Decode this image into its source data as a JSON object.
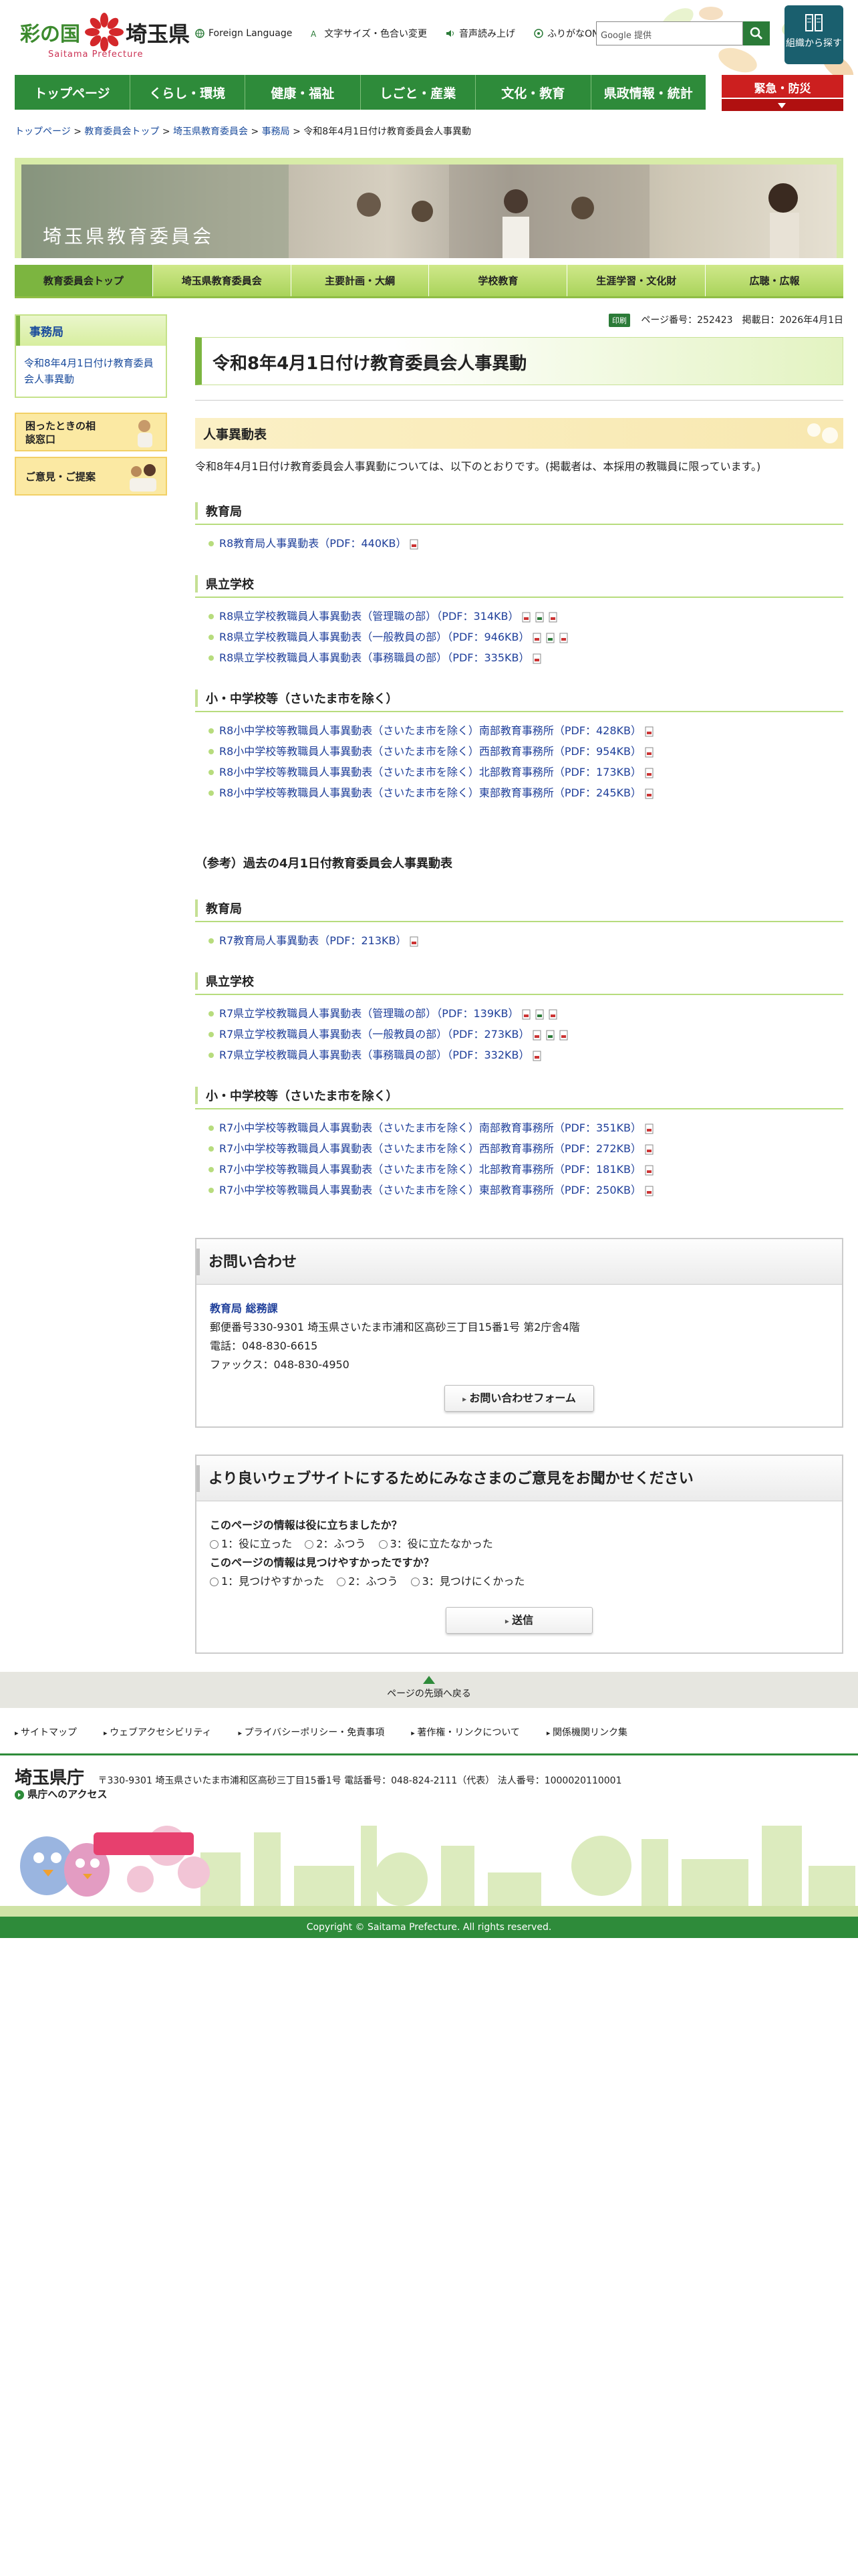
{
  "header": {
    "logo_text_sai": "彩の国",
    "logo_text_ken": "埼玉県",
    "logo_en": "Saitama Prefecture",
    "tools": [
      "Foreign Language",
      "文字サイズ・色合い変更",
      "音声読み上げ",
      "ふりがなON"
    ],
    "search_placeholder": "Google 提供",
    "org_button": "組織から探す"
  },
  "gnav": [
    "トップページ",
    "くらし・環境",
    "健康・福祉",
    "しごと・産業",
    "文化・教育",
    "県政情報・統計"
  ],
  "emergency": "緊急・防災",
  "breadcrumb": {
    "items": [
      "トップページ",
      "教育委員会トップ",
      "埼玉県教育委員会",
      "事務局"
    ],
    "current": "令和8年4月1日付け教育委員会人事異動",
    "sep": ">"
  },
  "banner": {
    "title": "埼玉県教育委員会"
  },
  "subnav": [
    "教育委員会トップ",
    "埼玉県教育委員会",
    "主要計画・大綱",
    "学校教育",
    "生涯学習・文化財",
    "広聴・広報"
  ],
  "side": {
    "head": "事務局",
    "link": "令和8年4月1日付け教育委員会人事異動",
    "btn1": "困ったときの相談窓口",
    "btn2": "ご意見・ご提案"
  },
  "page_info": {
    "badge": "印刷",
    "text": "ページ番号：252423　掲載日：2026年4月1日"
  },
  "title": "令和8年4月1日付け教育委員会人事異動",
  "section_title": "人事異動表",
  "lead": "令和8年4月1日付け教育委員会人事異動については、以下のとおりです。(掲載者は、本採用の教職員に限っています。)",
  "current": {
    "h_bureau": "教育局",
    "bureau_links": [
      "R8教育局人事異動表（PDF：440KB）"
    ],
    "h_pref": "県立学校",
    "pref_links": [
      "R8県立学校教職員人事異動表（管理職の部）（PDF：314KB）",
      "R8県立学校教職員人事異動表（一般教員の部）（PDF：946KB）",
      "R8県立学校教職員人事異動表（事務職員の部）（PDF：335KB）"
    ],
    "h_elem": "小・中学校等（さいたま市を除く）",
    "elem_links": [
      "R8小中学校等教職員人事異動表（さいたま市を除く）南部教育事務所（PDF：428KB）",
      "R8小中学校等教職員人事異動表（さいたま市を除く）西部教育事務所（PDF：954KB）",
      "R8小中学校等教職員人事異動表（さいたま市を除く）北部教育事務所（PDF：173KB）",
      "R8小中学校等教職員人事異動表（さいたま市を除く）東部教育事務所（PDF：245KB）"
    ]
  },
  "past": {
    "heading": "（参考）過去の4月1日付教育委員会人事異動表",
    "h_bureau": "教育局",
    "bureau_links": [
      "R7教育局人事異動表（PDF：213KB）"
    ],
    "h_pref": "県立学校",
    "pref_links": [
      "R7県立学校教職員人事異動表（管理職の部）（PDF：139KB）",
      "R7県立学校教職員人事異動表（一般教員の部）（PDF：273KB）",
      "R7県立学校教職員人事異動表（事務職員の部）（PDF：332KB）"
    ],
    "h_elem": "小・中学校等（さいたま市を除く）",
    "elem_links": [
      "R7小中学校等教職員人事異動表（さいたま市を除く）南部教育事務所（PDF：351KB）",
      "R7小中学校等教職員人事異動表（さいたま市を除く）西部教育事務所（PDF：272KB）",
      "R7小中学校等教職員人事異動表（さいたま市を除く）北部教育事務所（PDF：181KB）",
      "R7小中学校等教職員人事異動表（さいたま市を除く）東部教育事務所（PDF：250KB）"
    ]
  },
  "contact": {
    "head": "お問い合わせ",
    "dept": "教育局 総務課",
    "address": "郵便番号330-9301 埼玉県さいたま市浦和区高砂三丁目15番1号 第2庁舎4階",
    "tel": "電話：048-830-6615",
    "fax": "ファックス：048-830-4950",
    "form_btn": "お問い合わせフォーム"
  },
  "survey": {
    "head": "より良いウェブサイトにするためにみなさまのご意見をお聞かせください",
    "q1": "このページの情報は役に立ちましたか？",
    "q1_opts": [
      "1：役に立った",
      "2：ふつう",
      "3：役に立たなかった"
    ],
    "q2": "このページの情報は見つけやすかったですか？",
    "q2_opts": [
      "1：見つけやすかった",
      "2：ふつう",
      "3：見つけにくかった"
    ],
    "submit": "送信"
  },
  "footer": {
    "pagetop": "ページの先頭へ戻る",
    "links": [
      "サイトマップ",
      "ウェブアクセシビリティ",
      "プライバシーポリシー・免責事項",
      "著作権・リンクについて",
      "関係機関リンク集"
    ],
    "name": "埼玉県庁",
    "info": "〒330-9301 埼玉県さいたま市浦和区高砂三丁目15番1号 電話番号：048-824-2111（代表） 法人番号：1000020110001",
    "access": "県庁へのアクセス",
    "copyright": "Copyright © Saitama Prefecture. All rights reserved."
  },
  "colors": {
    "green": "#2e8b3a",
    "red": "#cc1f1f",
    "light_green": "#d8eca8",
    "link": "#1f3f9a"
  }
}
